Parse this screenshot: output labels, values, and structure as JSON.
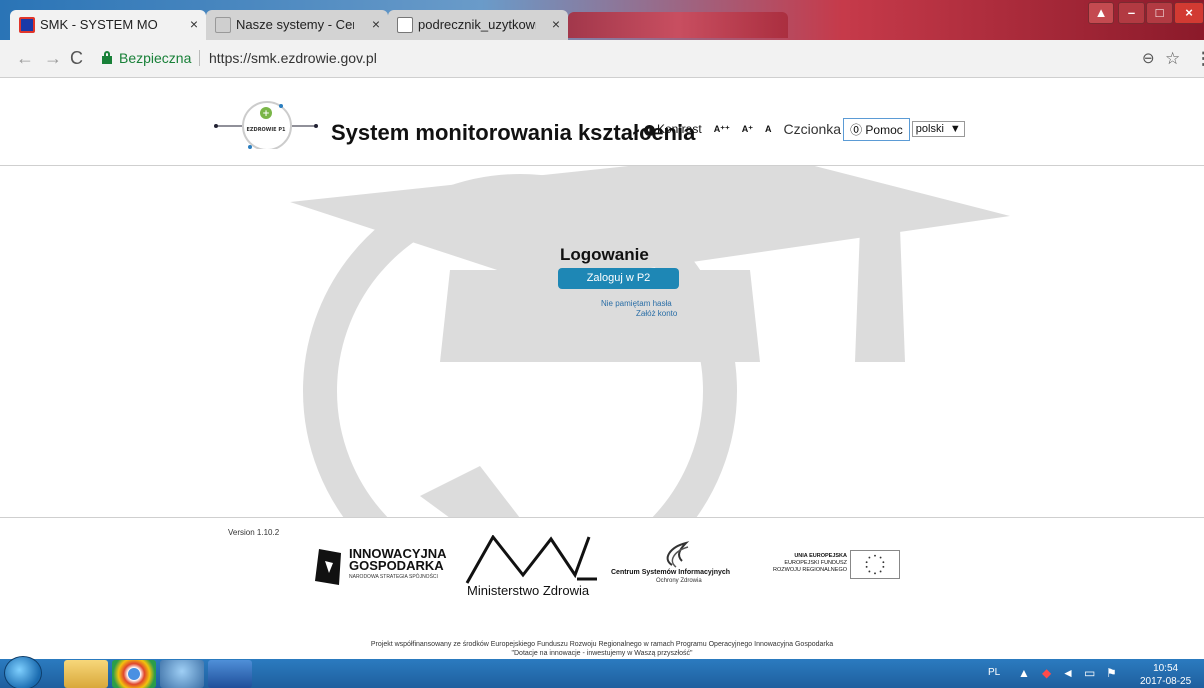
{
  "browser": {
    "tabs": [
      {
        "title": "SMK - SYSTEM MONITOI",
        "close": "×"
      },
      {
        "title": "Nasze systemy - Centrum",
        "close": "×"
      },
      {
        "title": "podrecznik_uzytkownika",
        "close": "×"
      }
    ],
    "secure_label": "Bezpieczna",
    "url": "https://smk.ezdrowie.gov.pl"
  },
  "header": {
    "logo_text": "EZDROWIE P1",
    "title": "System monitorowania kształcenia",
    "contrast_label": "Kontrast",
    "font_sizes": [
      "A⁺⁺",
      "A⁺",
      "A"
    ],
    "font_label": "Czcionka",
    "help_label": "Pomoc",
    "language": "polski"
  },
  "login": {
    "title": "Logowanie",
    "login_button": "Zaloguj w P2",
    "forgot_password": "Nie pamiętam hasła",
    "create_account": "Załóż konto"
  },
  "footer": {
    "version": "Version 1.10.2",
    "ig": {
      "line1": "INNOWACYJNA",
      "line2": "GOSPODARKA",
      "line3": "NARODOWA STRATEGIA SPÓJNOŚCI"
    },
    "mz": "Ministerstwo Zdrowia",
    "csi": {
      "line1": "Centrum Systemów Informacyjnych",
      "line2": "Ochrony Zdrowia"
    },
    "ue": {
      "line1": "UNIA EUROPEJSKA",
      "line2": "EUROPEJSKI FUNDUSZ",
      "line3": "ROZWOJU REGIONALNEGO"
    },
    "project_line1": "Projekt współfinansowany ze środków Europejskiego Funduszu Rozwoju Regionalnego w ramach Programu Operacyjnego Innowacyjna Gospodarka",
    "project_line2": "\"Dotacje na innowacje - inwestujemy w Waszą przyszłość\""
  },
  "taskbar": {
    "language": "PL",
    "time": "10:54",
    "date": "2017-08-25"
  }
}
